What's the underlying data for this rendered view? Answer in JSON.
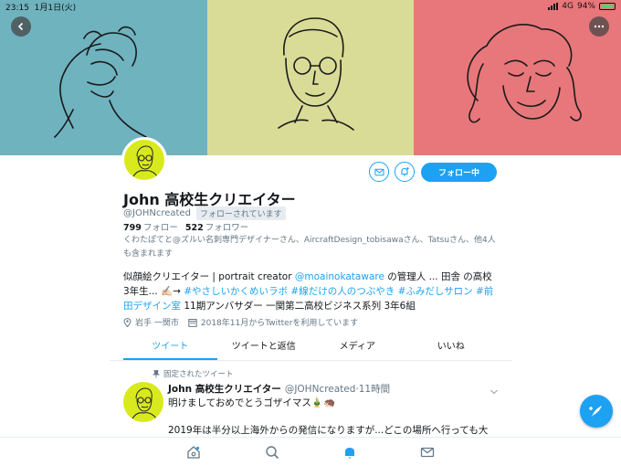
{
  "status": {
    "time": "23:15",
    "date": "1月1日(火)",
    "network": "4G",
    "battery": "94%",
    "battery_level": 0.94
  },
  "profile": {
    "name": "John  高校生クリエイター",
    "handle": "@JOHNcreated",
    "follows_you": "フォローされています",
    "following_count": "799",
    "following_label": "フォロー",
    "followers_count": "522",
    "followers_label": "フォロワー",
    "followers_you_know": "くわたぽてと@ズルい名刺専門デザイナーさん、AircraftDesign_tobisawaさん、Tatsuさん、他4人も含まれます",
    "bio": {
      "p1": "似顔絵クリエイター | portrait creator ",
      "p2": "@moainokataware",
      "p3": " の管理人 ... 田舎 の高校 3年生... ✍🏻→ ",
      "p4": "#やさしいかくめいラボ",
      "p5": " ",
      "p6": "#線だけの人のつぶやき",
      "p7": " ",
      "p8": "#ふみだしサロン",
      "p9": " ",
      "p10": "#前田デザイン室",
      "p11": " 11期アンバサダー 一関第二高校ビジネス系列 3年6組"
    },
    "location": "岩手 一関市",
    "joined": "2018年11月からTwitterを利用しています",
    "follow_button": "フォロー中"
  },
  "tabs": [
    "ツイート",
    "ツイートと返信",
    "メディア",
    "いいね"
  ],
  "pinned_tweet": {
    "pinned_label": "固定されたツイート",
    "author": "John  高校生クリエイター",
    "handle_time": "@JOHNcreated·11時間",
    "line1": "明けましておめでとうゴザイマス🎍🦔",
    "line2": "2019年は半分以上海外からの発信になりますが...どこの場所へ行っても大"
  },
  "colors": {
    "accent": "#1da1f2",
    "header_left": "#6fb3bf",
    "header_mid": "#d8dc97",
    "header_right": "#e7777a",
    "avatar_bg": "#d8ea1e"
  },
  "icons": [
    "back-icon",
    "more-icon",
    "mail-icon",
    "bell-plus-icon",
    "pin-icon",
    "location-icon",
    "calendar-icon",
    "chevron-down-icon",
    "compose-icon",
    "home-icon",
    "search-icon",
    "notifications-icon",
    "messages-icon"
  ]
}
